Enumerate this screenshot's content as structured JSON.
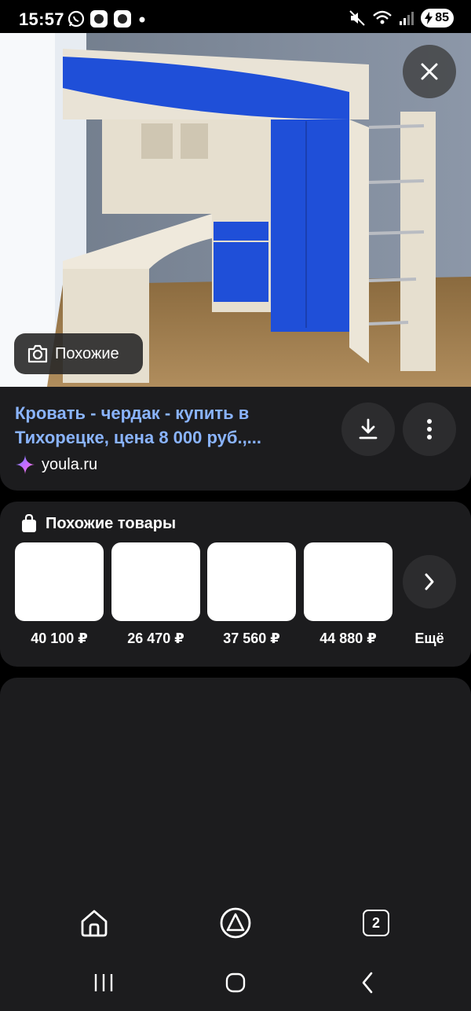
{
  "status_bar": {
    "time": "15:57",
    "left_icons": [
      "whatsapp-icon",
      "app-icon",
      "app-icon",
      "dot-icon"
    ],
    "right_icons": [
      "mute-icon",
      "wifi-icon",
      "signal-icon"
    ],
    "battery": "85"
  },
  "photo": {
    "similar_label": "Похожие"
  },
  "result": {
    "title": "Кровать - чердак - купить в\nТихорецке, цена 8 000 руб.,...",
    "source": "youla.ru"
  },
  "similar_products": {
    "heading": "Похожие товары",
    "items": [
      {
        "price": "40 100 ₽"
      },
      {
        "price": "26 470 ₽"
      },
      {
        "price": "37 560 ₽"
      },
      {
        "price": "44 880 ₽"
      }
    ],
    "more_label": "Ещё"
  },
  "bottom_nav": {
    "tab_count": "2"
  },
  "colors": {
    "link": "#8ab4ff",
    "card": "#1c1c1e",
    "button": "#2c2c2e",
    "furniture_blue": "#1f4fd8"
  }
}
